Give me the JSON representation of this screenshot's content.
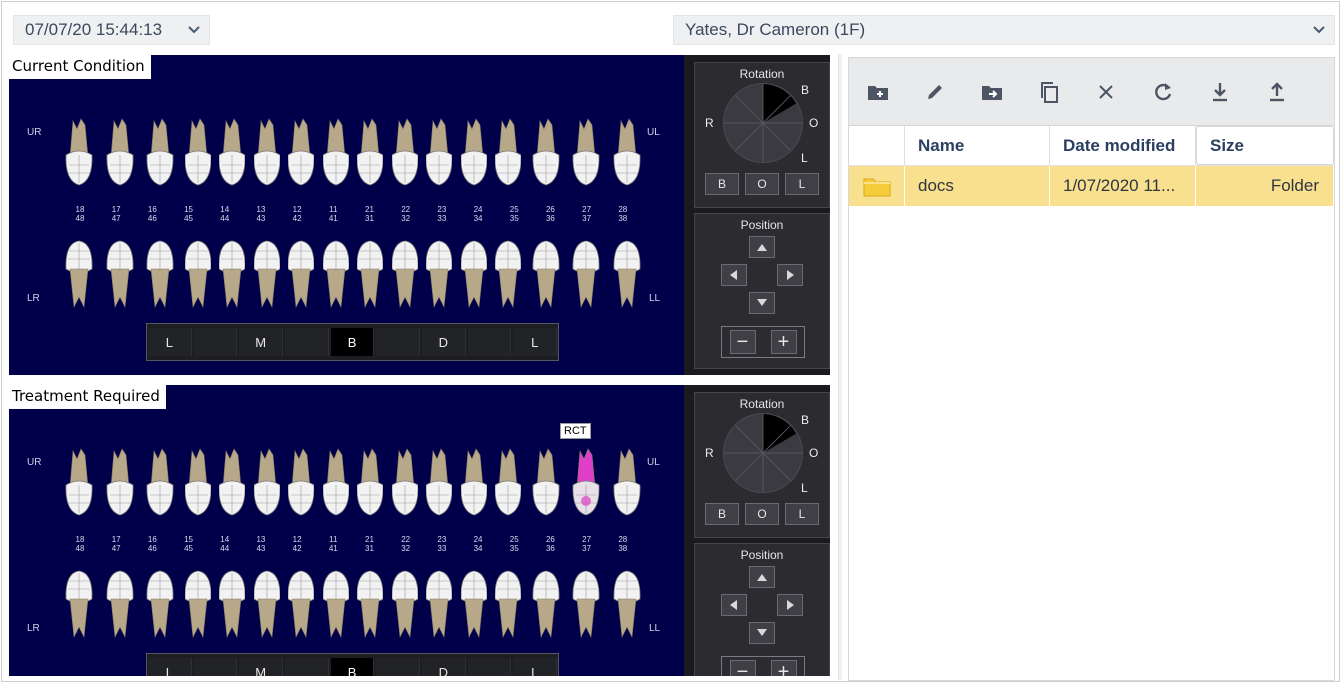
{
  "header": {
    "datetime_value": "07/07/20 15:44:13",
    "patient_value": "Yates, Dr Cameron (1F)"
  },
  "charts": [
    {
      "title": "Current Condition",
      "quadrants": {
        "ur": "UR",
        "ul": "UL",
        "lr": "LR",
        "ll": "LL"
      },
      "upper_numbers": [
        "18\n48",
        "17\n47",
        "16\n46",
        "15\n45",
        "14\n44",
        "13\n43",
        "12\n42",
        "11\n41",
        "21\n31",
        "22\n32",
        "23\n33",
        "24\n34",
        "25\n35",
        "26\n36",
        "27\n37",
        "28\n38"
      ],
      "surfaces": [
        "L",
        "",
        "M",
        "",
        "B",
        "",
        "D",
        "",
        "L"
      ],
      "selected_surface": "B"
    },
    {
      "title": "Treatment Required",
      "quadrants": {
        "ur": "UR",
        "ul": "UL",
        "lr": "LR",
        "ll": "LL"
      },
      "annotation": "RCT",
      "surfaces": [
        "L",
        "",
        "M",
        "",
        "B",
        "",
        "D",
        "",
        "L"
      ],
      "selected_surface": "B"
    }
  ],
  "controls": {
    "rotation_label": "Rotation",
    "rotation_dirs": {
      "b": "B",
      "r": "R",
      "o": "O",
      "l": "L"
    },
    "rotation_buttons": [
      "B",
      "O",
      "L"
    ],
    "position_label": "Position",
    "zoom_out": "−",
    "zoom_in": "+"
  },
  "files": {
    "toolbar_icons": [
      "new-folder-icon",
      "edit-icon",
      "move-to-folder-icon",
      "copy-icon",
      "close-icon",
      "refresh-icon",
      "download-icon",
      "upload-icon"
    ],
    "columns": {
      "name": "Name",
      "modified": "Date modified",
      "size": "Size"
    },
    "rows": [
      {
        "icon": "folder-icon",
        "name": "docs",
        "modified": "1/07/2020 11...",
        "size": "Folder"
      }
    ]
  },
  "colors": {
    "chart_bg": "#00004a",
    "tooth": "#f2f2f2",
    "root": "#b8a88a",
    "treatment_highlight": "#e040c8",
    "selected_row": "#f8e08e",
    "folder": "#f5cd3a"
  }
}
